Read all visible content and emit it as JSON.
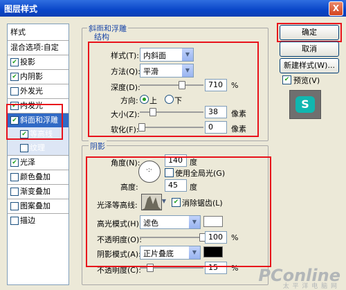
{
  "window": {
    "title": "图层样式",
    "close": "X"
  },
  "sidebar": {
    "header": "样式",
    "blend_options": "混合选项:自定",
    "items": [
      {
        "label": "投影",
        "checked": true
      },
      {
        "label": "内阴影",
        "checked": true
      },
      {
        "label": "外发光",
        "checked": false
      },
      {
        "label": "内发光",
        "checked": true
      },
      {
        "label": "斜面和浮雕",
        "checked": true,
        "selected": true
      },
      {
        "label": "等高线",
        "checked": true,
        "sub": true
      },
      {
        "label": "纹理",
        "checked": false,
        "sub": true
      },
      {
        "label": "光泽",
        "checked": true
      },
      {
        "label": "颜色叠加",
        "checked": false
      },
      {
        "label": "渐变叠加",
        "checked": false
      },
      {
        "label": "图案叠加",
        "checked": false
      },
      {
        "label": "描边",
        "checked": false
      }
    ]
  },
  "bevel": {
    "group_title": "斜面和浮雕",
    "structure_title": "结构",
    "style_label": "样式(T):",
    "style_value": "内斜面",
    "method_label": "方法(Q):",
    "method_value": "平滑",
    "depth_label": "深度(D):",
    "depth_value": "710",
    "depth_unit": "%",
    "direction_label": "方向:",
    "direction_up": "上",
    "direction_down": "下",
    "size_label": "大小(Z):",
    "size_value": "38",
    "size_unit": "像素",
    "soften_label": "软化(F):",
    "soften_value": "0",
    "soften_unit": "像素"
  },
  "shading": {
    "title": "阴影",
    "angle_label": "角度(N):",
    "angle_value": "140",
    "angle_unit": "度",
    "global_light": "使用全局光(G)",
    "altitude_label": "高度:",
    "altitude_value": "45",
    "altitude_unit": "度",
    "gloss_label": "光泽等高线:",
    "antialias": "消除锯齿(L)",
    "highlight_label": "高光模式(H):",
    "highlight_mode": "滤色",
    "highlight_color": "#ffffff",
    "opacity1_label": "不透明度(O):",
    "opacity1_value": "100",
    "opacity1_unit": "%",
    "shadow_label": "阴影模式(A):",
    "shadow_mode": "正片叠底",
    "shadow_color": "#000000",
    "opacity2_label": "不透明度(C):",
    "opacity2_value": "15",
    "opacity2_unit": "%"
  },
  "buttons": {
    "ok": "确定",
    "cancel": "取消",
    "new_style": "新建样式(W)...",
    "preview": "预览(V)"
  },
  "watermark": {
    "brand": "PConline",
    "sub": "太 平 洋 电 脑 网"
  },
  "colors": {
    "highlight_red": "#e8121b",
    "selection_blue": "#316ac5",
    "title_bar": "#0a46c8"
  }
}
